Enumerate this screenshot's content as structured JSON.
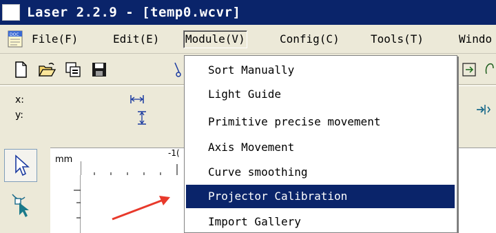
{
  "window": {
    "title": "Laser 2.2.9 - [temp0.wcvr]"
  },
  "menubar": {
    "items": [
      {
        "label": "File(F)",
        "name": "menu-file"
      },
      {
        "label": "Edit(E)",
        "name": "menu-edit"
      },
      {
        "label": "Module(V)",
        "name": "menu-module"
      },
      {
        "label": "Config(C)",
        "name": "menu-config"
      },
      {
        "label": "Tools(T)",
        "name": "menu-tools"
      },
      {
        "label": "Windo",
        "name": "menu-window"
      }
    ]
  },
  "coords": {
    "x_label": "x:",
    "y_label": "y:"
  },
  "ruler": {
    "unit": "mm",
    "top_label": "-1("
  },
  "dropdown": {
    "items": [
      {
        "label": "Sort Manually"
      },
      {
        "label": "Light Guide"
      },
      {
        "label": "Primitive precise movement"
      },
      {
        "label": "Axis Movement"
      },
      {
        "label": "Curve smoothing"
      },
      {
        "label": "Projector Calibration",
        "selected": true
      },
      {
        "label": "Import Gallery"
      }
    ]
  },
  "colors": {
    "titlebar": "#0a246a",
    "selection": "#0a246a",
    "face": "#ece9d8",
    "arrow": "#e8392b"
  },
  "icons": {
    "toolbar": [
      "new-file-icon",
      "open-folder-icon",
      "copy-icon",
      "save-icon",
      "cut-icon",
      "mirror-icon",
      "hand-icon"
    ],
    "coords": [
      "width-icon",
      "height-icon",
      "move-icon"
    ],
    "tools": [
      "select-arrow-icon",
      "node-edit-icon"
    ]
  }
}
